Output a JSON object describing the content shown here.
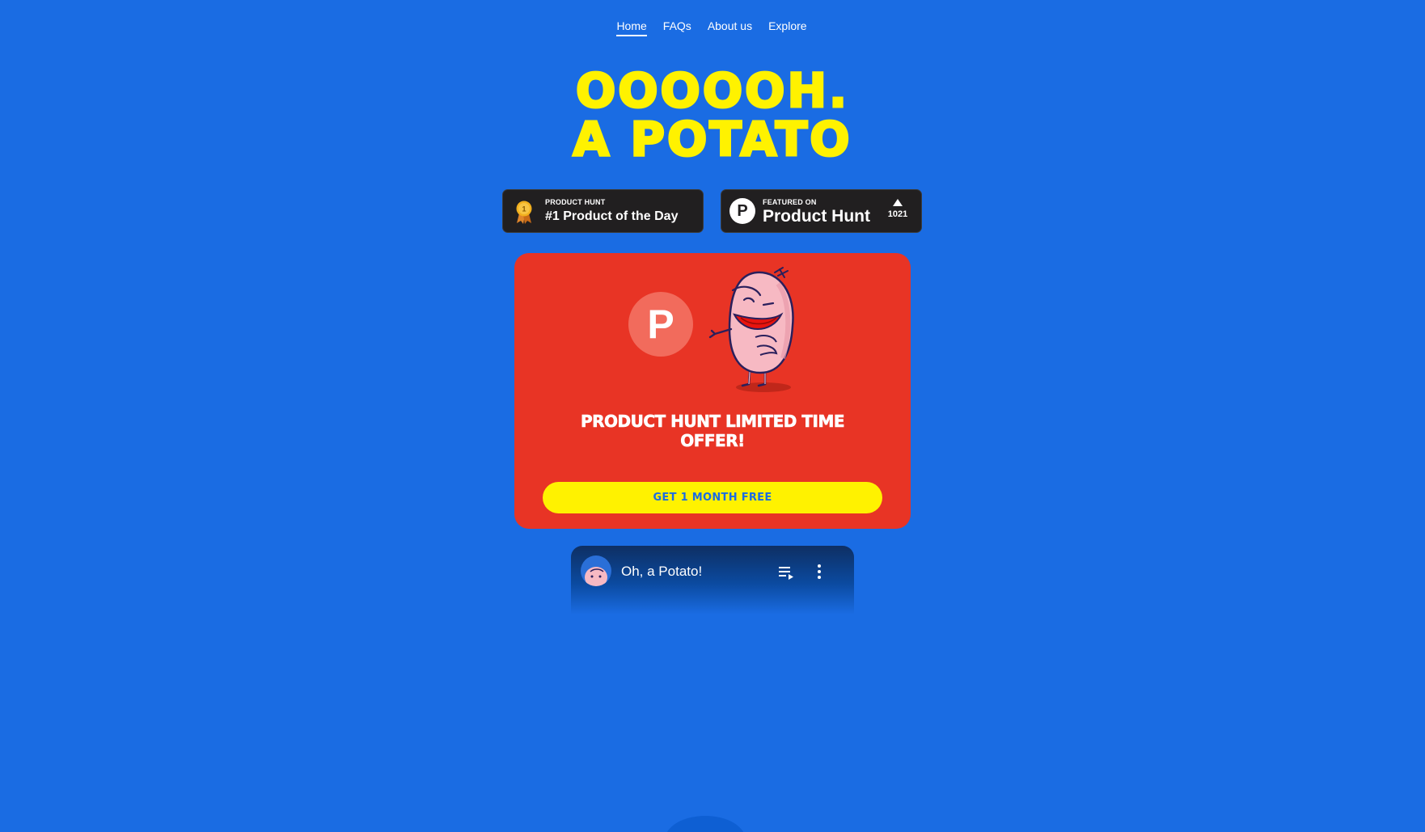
{
  "nav": {
    "items": [
      {
        "label": "Home",
        "active": true
      },
      {
        "label": "FAQs",
        "active": false
      },
      {
        "label": "About us",
        "active": false
      },
      {
        "label": "Explore",
        "active": false
      }
    ]
  },
  "hero": {
    "line1": "OOOOOH.",
    "line2": "A POTATO"
  },
  "badges": {
    "product_of_day": {
      "small": "PRODUCT HUNT",
      "big": "#1 Product of the Day",
      "medal_number": "1"
    },
    "featured": {
      "small": "FEATURED ON",
      "big": "Product Hunt",
      "logo_letter": "P",
      "votes": "1021"
    }
  },
  "offer": {
    "logo_letter": "P",
    "title": "PRODUCT HUNT LIMITED TIME OFFER!",
    "cta_label": "GET 1 MONTH FREE"
  },
  "video": {
    "title": "Oh, a Potato!"
  },
  "colors": {
    "background": "#1a6ce3",
    "hero_yellow": "#fff200",
    "offer_red": "#e83425",
    "badge_dark": "#211f20"
  },
  "icons": {
    "medal": "medal-icon",
    "product_hunt": "product-hunt-logo-icon",
    "upvote": "upvote-arrow-icon",
    "potato_mascot": "potato-mascot-icon",
    "playlist": "playlist-icon",
    "more": "more-vertical-icon"
  }
}
